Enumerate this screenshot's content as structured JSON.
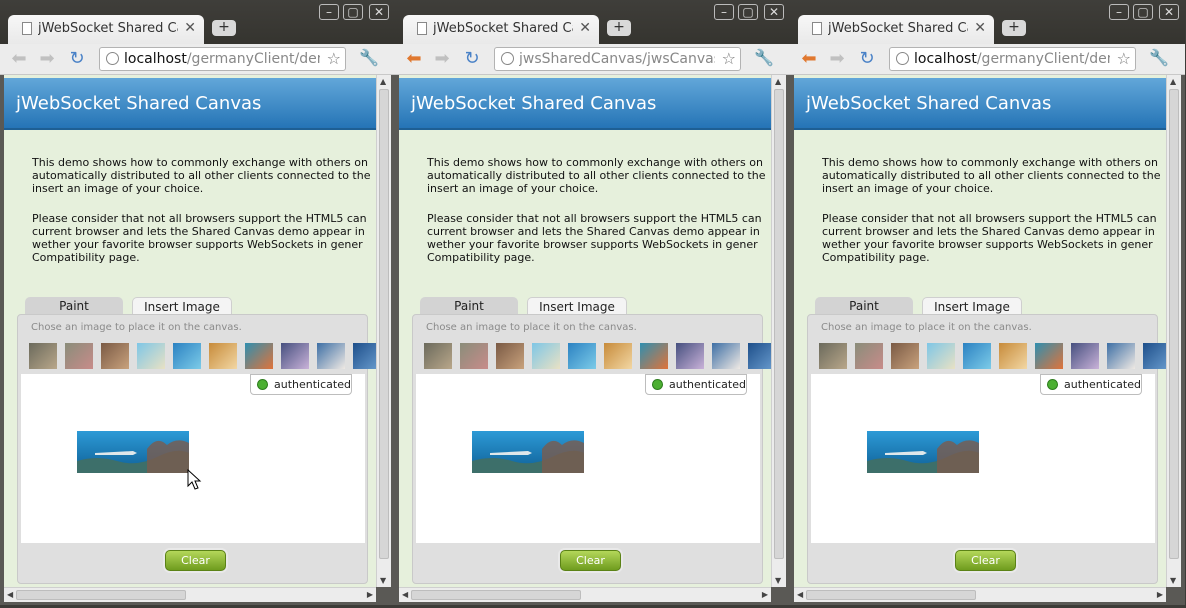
{
  "windows": [
    {
      "tab_title": "jWebSocket Shared Canvas",
      "url_host": "localhost",
      "url_path": "/germanyClient/dem",
      "back_enabled": false,
      "show_cursor": true
    },
    {
      "tab_title": "jWebSocket Shared Canvas",
      "url_host": "",
      "url_path": "jwsSharedCanvas/jwsCanvas.h",
      "back_enabled": true,
      "show_cursor": false
    },
    {
      "tab_title": "jWebSocket Shared Canvas",
      "url_host": "localhost",
      "url_path": "/germanyClient/dem",
      "back_enabled": true,
      "show_cursor": false
    }
  ],
  "page": {
    "header_title": "jWebSocket Shared Canvas",
    "paragraph1": [
      "This demo shows how to commonly exchange with others on",
      "automatically distributed to all other clients connected to the",
      "insert an image of your choice."
    ],
    "paragraph2": [
      "Please consider that not all browsers support the HTML5 can",
      "current browser and lets the Shared Canvas demo appear in",
      "wether your favorite browser supports WebSockets in gener",
      "Compatibility page."
    ],
    "tabs": [
      "Paint",
      "Insert Image"
    ],
    "active_tab": "Insert Image",
    "hint": "Chose an image to place it on the canvas.",
    "status": "authenticated",
    "clear_label": "Clear",
    "thumbnails": [
      {
        "icon": "grey-reef-image",
        "c1": "#6b6a5c",
        "c2": "#b9a78a"
      },
      {
        "icon": "coral-image",
        "c1": "#8a8d7a",
        "c2": "#c88c8a"
      },
      {
        "icon": "diver-image",
        "c1": "#7a5a45",
        "c2": "#c9a27c"
      },
      {
        "icon": "beach-image",
        "c1": "#7ec6e6",
        "c2": "#e9e1c4"
      },
      {
        "icon": "underwater-image",
        "c1": "#2c82c2",
        "c2": "#7ccbe8"
      },
      {
        "icon": "shell-image",
        "c1": "#c78b3a",
        "c2": "#f2d7a4"
      },
      {
        "icon": "reef-fish-image",
        "c1": "#2f8fb0",
        "c2": "#e0733a"
      },
      {
        "icon": "purple-coral-image",
        "c1": "#46507f",
        "c2": "#c9b2d9"
      },
      {
        "icon": "white-coral-image",
        "c1": "#3d6fa5",
        "c2": "#efe9e4"
      },
      {
        "icon": "blue-water-image",
        "c1": "#1e4f8a",
        "c2": "#6b9ed0"
      }
    ]
  },
  "colors": {
    "header": "#2f80c0",
    "page_background": "#e6f0dc",
    "status_ok": "#4caf32",
    "clear_button": "#8cb52f"
  }
}
